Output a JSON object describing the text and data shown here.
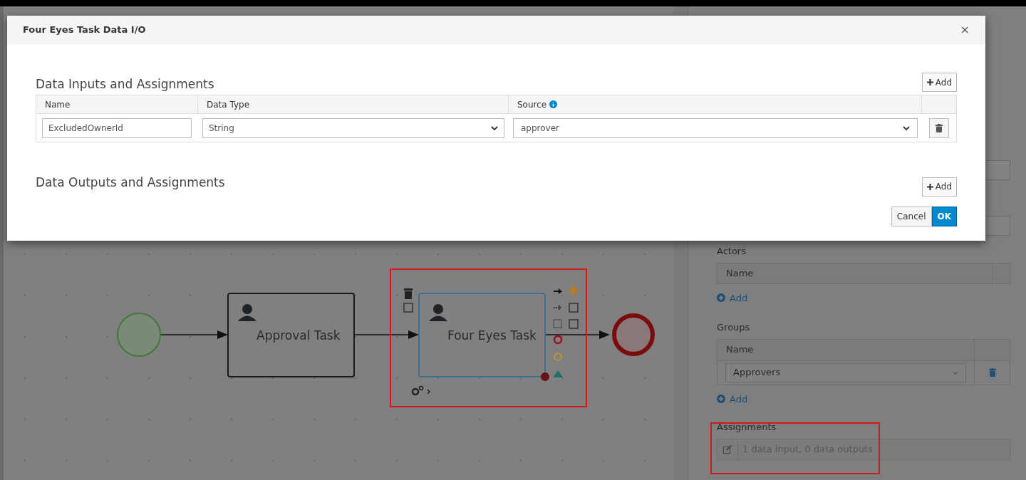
{
  "modal": {
    "title": "Four Eyes Task Data I/O",
    "close": "×",
    "inputs": {
      "heading": "Data Inputs and Assignments",
      "add": "Add",
      "columns": [
        "Name",
        "Data Type",
        "Source"
      ],
      "rows": [
        {
          "name": "ExcludedOwnerId",
          "data_type": "String",
          "source": "approver"
        }
      ]
    },
    "outputs": {
      "heading": "Data Outputs and Assignments",
      "add": "Add"
    },
    "buttons": [
      {
        "label": "Cancel",
        "kind": "default"
      },
      {
        "label": "OK",
        "kind": "primary"
      }
    ]
  },
  "diagram": {
    "nodes": [
      {
        "kind": "start"
      },
      {
        "kind": "task",
        "label": "Approval Task",
        "selected": false
      },
      {
        "kind": "task",
        "label": "Four Eyes Task",
        "selected": true
      },
      {
        "kind": "end"
      }
    ]
  },
  "properties": {
    "actors": {
      "label": "Actors",
      "column": "Name",
      "add": "Add"
    },
    "groups": {
      "label": "Groups",
      "column": "Name",
      "rows": [
        "Approvers"
      ],
      "add": "Add"
    },
    "assignments": {
      "label": "Assignments",
      "value": "1 data input, 0 data outputs"
    }
  }
}
